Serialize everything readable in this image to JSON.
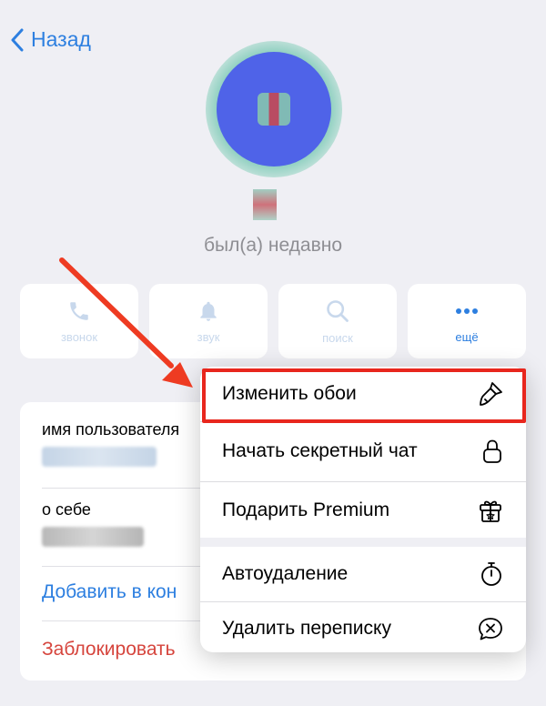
{
  "nav": {
    "back_label": "Назад"
  },
  "profile": {
    "status": "был(а) недавно"
  },
  "actions": [
    {
      "label": "звонок",
      "icon": "phone-icon"
    },
    {
      "label": "звук",
      "icon": "bell-icon"
    },
    {
      "label": "поиск",
      "icon": "search-icon"
    },
    {
      "label": "ещё",
      "icon": "more-icon"
    }
  ],
  "info": {
    "username_label": "имя пользователя",
    "about_label": "о себе",
    "add_contact": "Добавить в кон",
    "block": "Заблокировать"
  },
  "menu": {
    "items": [
      {
        "label": "Изменить обои",
        "icon": "brush-icon"
      },
      {
        "label": "Начать секретный чат",
        "icon": "lock-icon"
      },
      {
        "label": "Подарить Premium",
        "icon": "gift-icon"
      },
      {
        "label": "Автоудаление",
        "icon": "timer-icon"
      },
      {
        "label": "Удалить переписку",
        "icon": "delete-chat-icon"
      }
    ]
  },
  "colors": {
    "accent": "#2d7fe0",
    "danger": "#d6453d",
    "highlight_border": "#e8261d",
    "arrow": "#ee3b22"
  }
}
